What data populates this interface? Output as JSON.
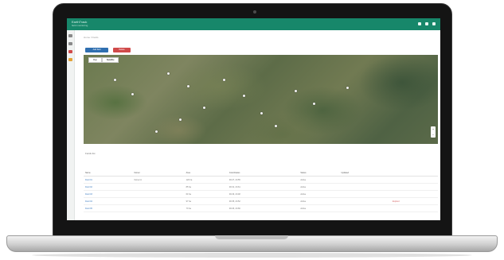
{
  "app": {
    "title": "EarthTrack",
    "subtitle": "field monitoring"
  },
  "top_icons": [
    "bell-icon",
    "user-icon",
    "menu-icon"
  ],
  "sidebar": {
    "items": [
      {
        "icon": "home-icon",
        "color": "#888888"
      },
      {
        "icon": "map-icon",
        "color": "#888888"
      },
      {
        "icon": "alert-icon",
        "color": "#d04a4a"
      },
      {
        "icon": "settings-icon",
        "color": "#e3a236"
      }
    ]
  },
  "breadcrumb": "Home / Fields",
  "toolbar": {
    "primary_label": "Add field",
    "danger_label": "Delete"
  },
  "map": {
    "map_types": [
      "Map",
      "Satellite"
    ],
    "active_type": "Satellite",
    "zoom_in": "+",
    "zoom_out": "−"
  },
  "list": {
    "title": "Fields list",
    "columns": [
      "Name",
      "Owner",
      "Area",
      "Coordinates",
      "Status",
      "Updated",
      ""
    ],
    "rows": [
      [
        "Field 01",
        "Owner A",
        "120 ha",
        "48.27, 20.55",
        "Active",
        "",
        ""
      ],
      [
        "Field 02",
        "",
        "85 ha",
        "48.31, 20.61",
        "Active",
        "",
        ""
      ],
      [
        "Field 03",
        "",
        "64 ha",
        "48.29, 20.48",
        "Active",
        "",
        ""
      ],
      [
        "Field 04",
        "",
        "97 ha",
        "48.35, 20.52",
        "Active",
        "",
        "Expired"
      ],
      [
        "Field 05",
        "",
        "73 ha",
        "48.26, 20.66",
        "Active",
        "",
        ""
      ]
    ]
  },
  "colors": {
    "header": "#17876a",
    "primary": "#2f6fb0",
    "danger": "#d04a4a"
  }
}
